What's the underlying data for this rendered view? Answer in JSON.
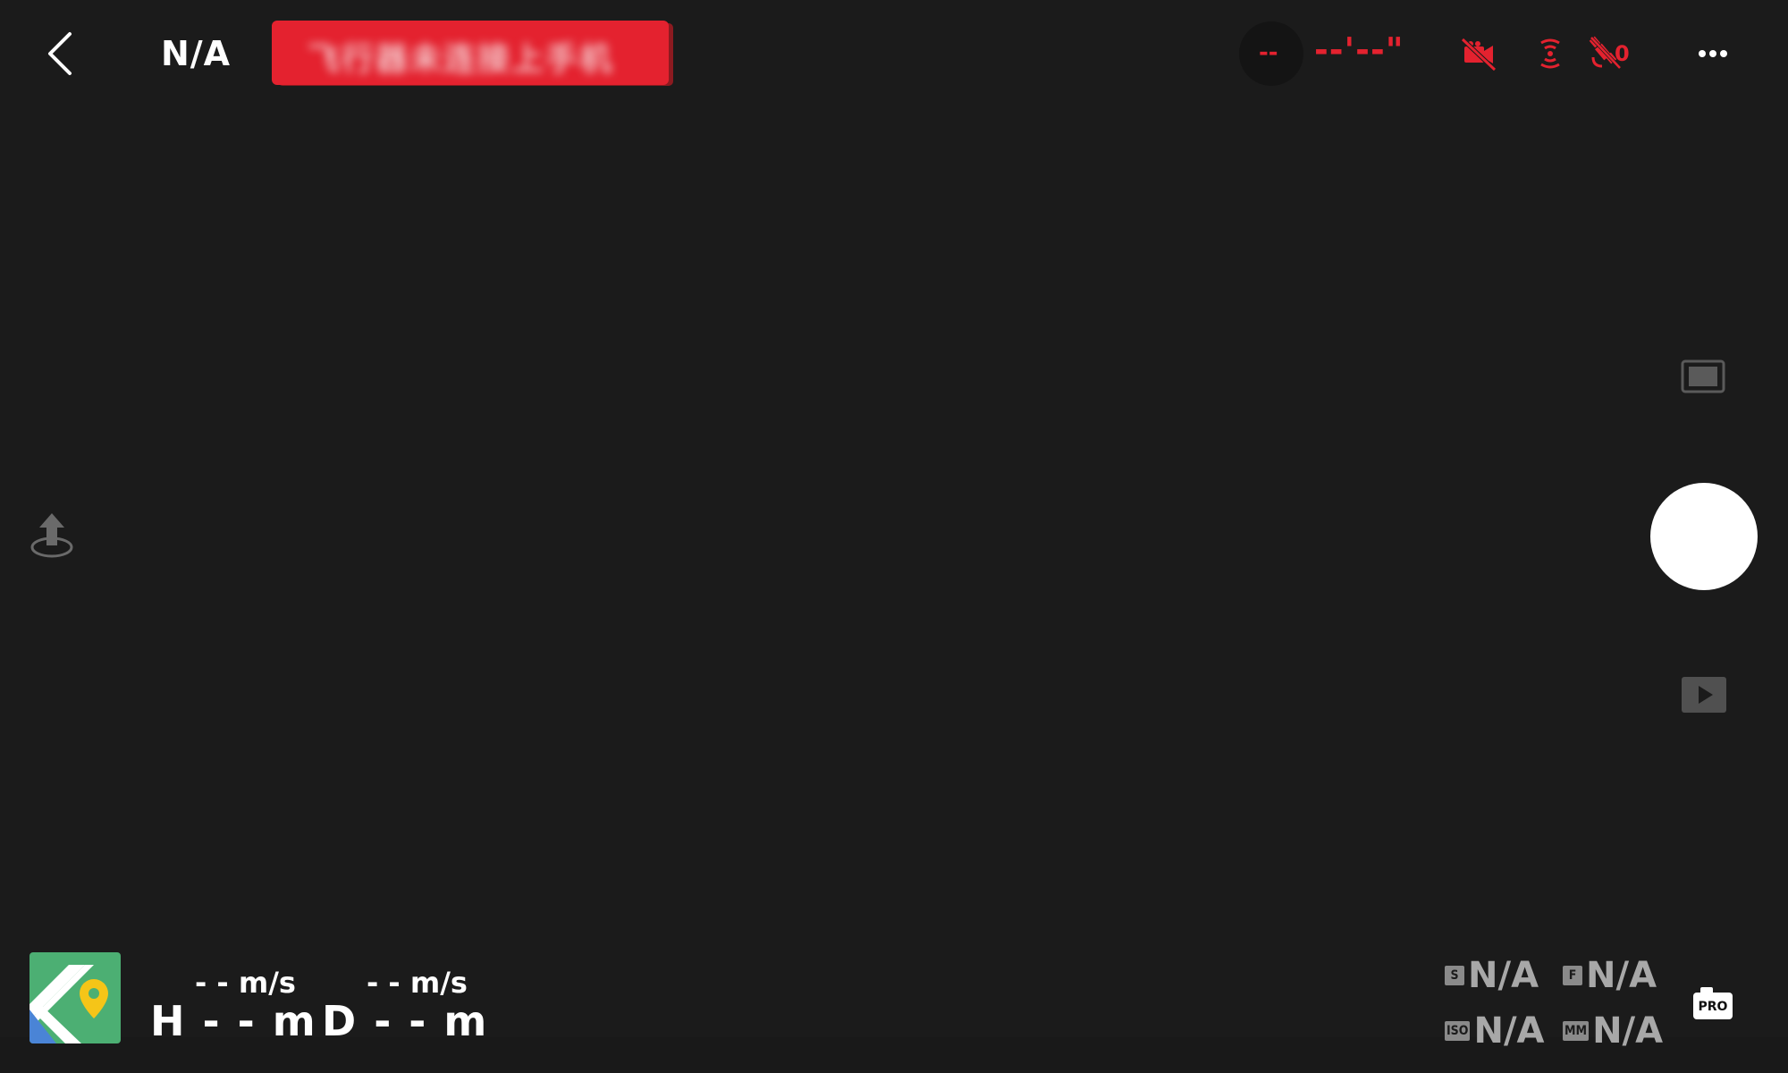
{
  "header": {
    "mode_label": "N/A",
    "status_banner_text": "飞行器未连接上手机",
    "battery_value": "--",
    "flight_time": "--'--\"",
    "satellite_count": "0"
  },
  "telemetry": {
    "horizontal_speed": "- - m/s",
    "vertical_speed": "- - m/s",
    "height": "H - - m",
    "distance": "D - - m"
  },
  "camera_params": {
    "shutter": {
      "tag": "S",
      "value": "N/A"
    },
    "fstop": {
      "tag": "F",
      "value": "N/A"
    },
    "iso": {
      "tag": "ISO",
      "value": "N/A"
    },
    "focal": {
      "tag": "MM",
      "value": "N/A"
    }
  },
  "pro_button_label": "PRO",
  "colors": {
    "background": "#1b1b1b",
    "alert_red": "#e4222f",
    "text_white": "#ffffff",
    "param_gray": "#a8a8a8"
  },
  "icons": {
    "back": "chevron-left-icon",
    "no_video": "video-off-icon",
    "rc_signal": "rc-signal-icon",
    "satellite": "satellite-icon",
    "more": "more-horizontal-icon",
    "aspect": "aspect-ratio-icon",
    "playback": "play-icon",
    "takeoff": "takeoff-icon",
    "map": "map-icon",
    "pro_camera": "camera-pro-icon"
  }
}
